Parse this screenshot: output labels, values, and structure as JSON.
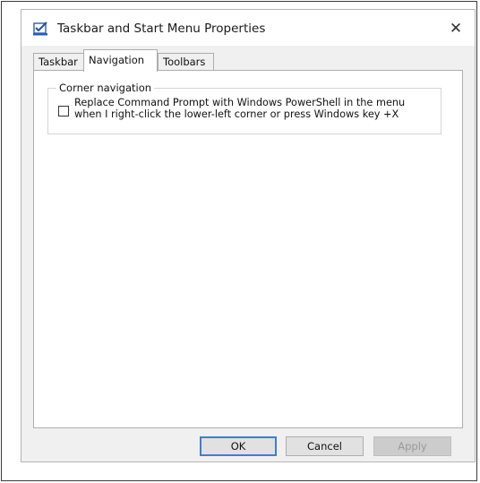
{
  "window": {
    "title": "Taskbar and Start Menu Properties",
    "close_glyph": "✕",
    "icon": "taskbar-checkmark-icon"
  },
  "tabs": [
    {
      "label": "Taskbar",
      "active": false
    },
    {
      "label": "Navigation",
      "active": true
    },
    {
      "label": "Toolbars",
      "active": false
    }
  ],
  "corner_navigation": {
    "group_label": "Corner navigation",
    "checkbox_checked": false,
    "checkbox_line1": "Replace Command Prompt with Windows PowerShell in the menu",
    "checkbox_line2": "when I right-click the lower-left corner or press Windows key +X"
  },
  "buttons": {
    "ok": "OK",
    "cancel": "Cancel",
    "apply": "Apply"
  },
  "colors": {
    "accent": "#3c7fd1",
    "dialog_bg": "#f0f0f0"
  }
}
